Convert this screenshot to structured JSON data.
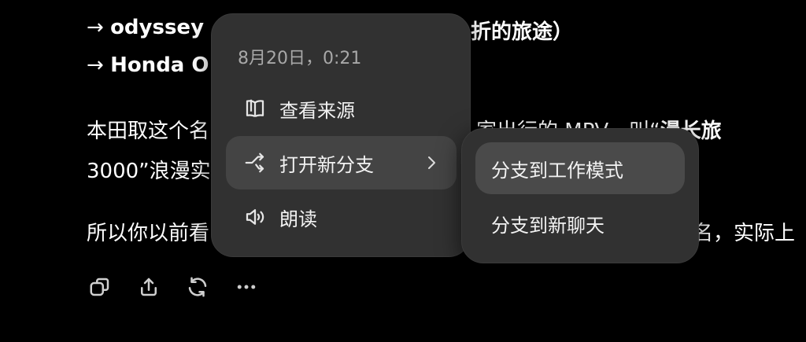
{
  "content": {
    "line1_arrow": "→",
    "line1_bold": "odyssey",
    "line1_tail": "折的旅途）",
    "line2_arrow": "→",
    "line2_bold": "Honda O",
    "para1_lead": "本田取这个名",
    "para1_mid": "家出行的 MPV，叫“",
    "para1_bold": "漫长旅",
    "para2": "3000”浪漫实",
    "para3_lead": "所以你以前看",
    "para3_tail": "名，实际上"
  },
  "context_menu": {
    "timestamp": "8月20日，0:21",
    "items": [
      {
        "label": "查看来源",
        "icon": "book-icon"
      },
      {
        "label": "打开新分支",
        "icon": "branch-icon"
      },
      {
        "label": "朗读",
        "icon": "speaker-icon"
      }
    ]
  },
  "submenu": {
    "items": [
      {
        "label": "分支到工作模式"
      },
      {
        "label": "分支到新聊天"
      }
    ]
  },
  "action_bar": {
    "icons": [
      "copy-icon",
      "share-icon",
      "regenerate-icon",
      "more-icon"
    ]
  }
}
